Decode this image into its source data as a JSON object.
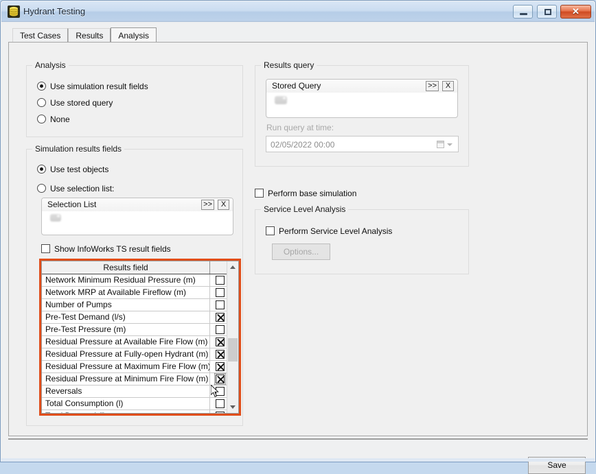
{
  "window": {
    "title": "Hydrant Testing",
    "icon": "database-icon",
    "controls": {
      "minimize": "minimize-icon",
      "maximize": "maximize-icon",
      "close": "✕"
    }
  },
  "tabs": [
    {
      "label": "Test Cases",
      "active": false
    },
    {
      "label": "Results",
      "active": false
    },
    {
      "label": "Analysis",
      "active": true
    }
  ],
  "analysis_group": {
    "title": "Analysis",
    "options": [
      {
        "label": "Use simulation result fields",
        "selected": true
      },
      {
        "label": "Use stored query",
        "selected": false
      },
      {
        "label": "None",
        "selected": false
      }
    ]
  },
  "simulation_group": {
    "title": "Simulation results fields",
    "options": [
      {
        "label": "Use test objects",
        "selected": true
      },
      {
        "label": "Use selection list:",
        "selected": false
      }
    ],
    "selection_list": {
      "title": "Selection List",
      "expand_label": ">>",
      "clear_label": "X"
    },
    "show_ts_fields": {
      "label": "Show InfoWorks TS result fields",
      "checked": false
    }
  },
  "results_grid": {
    "header": "Results field",
    "rows": [
      {
        "label": "Network Minimum Residual Pressure (m)",
        "checked": false
      },
      {
        "label": "Network MRP at Available Fireflow (m)",
        "checked": false
      },
      {
        "label": "Number of Pumps",
        "checked": false
      },
      {
        "label": "Pre-Test Demand (l/s)",
        "checked": true
      },
      {
        "label": "Pre-Test Pressure (m)",
        "checked": false
      },
      {
        "label": "Residual Pressure at Available Fire Flow (m)",
        "checked": true
      },
      {
        "label": "Residual Pressure at Fully-open Hydrant (m)",
        "checked": true
      },
      {
        "label": "Residual Pressure at Maximum Fire Flow (m)",
        "checked": true
      },
      {
        "label": "Residual Pressure at Minimum Fire Flow (m)",
        "checked": true,
        "focused": true
      },
      {
        "label": "Reversals",
        "checked": false
      },
      {
        "label": "Total Consumption (l)",
        "checked": false
      },
      {
        "label": "Total Demand (l)",
        "checked": false
      }
    ]
  },
  "results_query": {
    "title": "Results query",
    "stored_query": {
      "title": "Stored Query",
      "expand_label": ">>",
      "clear_label": "X"
    },
    "run_at_label": "Run query at time:",
    "run_at_value": "02/05/2022 00:00",
    "calendar_icon": "calendar-icon",
    "dropdown_icon": "chevron-down-icon"
  },
  "base_simulation": {
    "label": "Perform base simulation",
    "checked": false
  },
  "service_level": {
    "title": "Service Level Analysis",
    "perform": {
      "label": "Perform Service Level Analysis",
      "checked": false
    },
    "options_button": "Options..."
  },
  "footer": {
    "save_label": "Save"
  },
  "colors": {
    "highlight": "#e04e1b",
    "title_bar": "#bdd2ea",
    "dialog_bg": "#f0f0f0",
    "close_button": "#cf4b22"
  }
}
